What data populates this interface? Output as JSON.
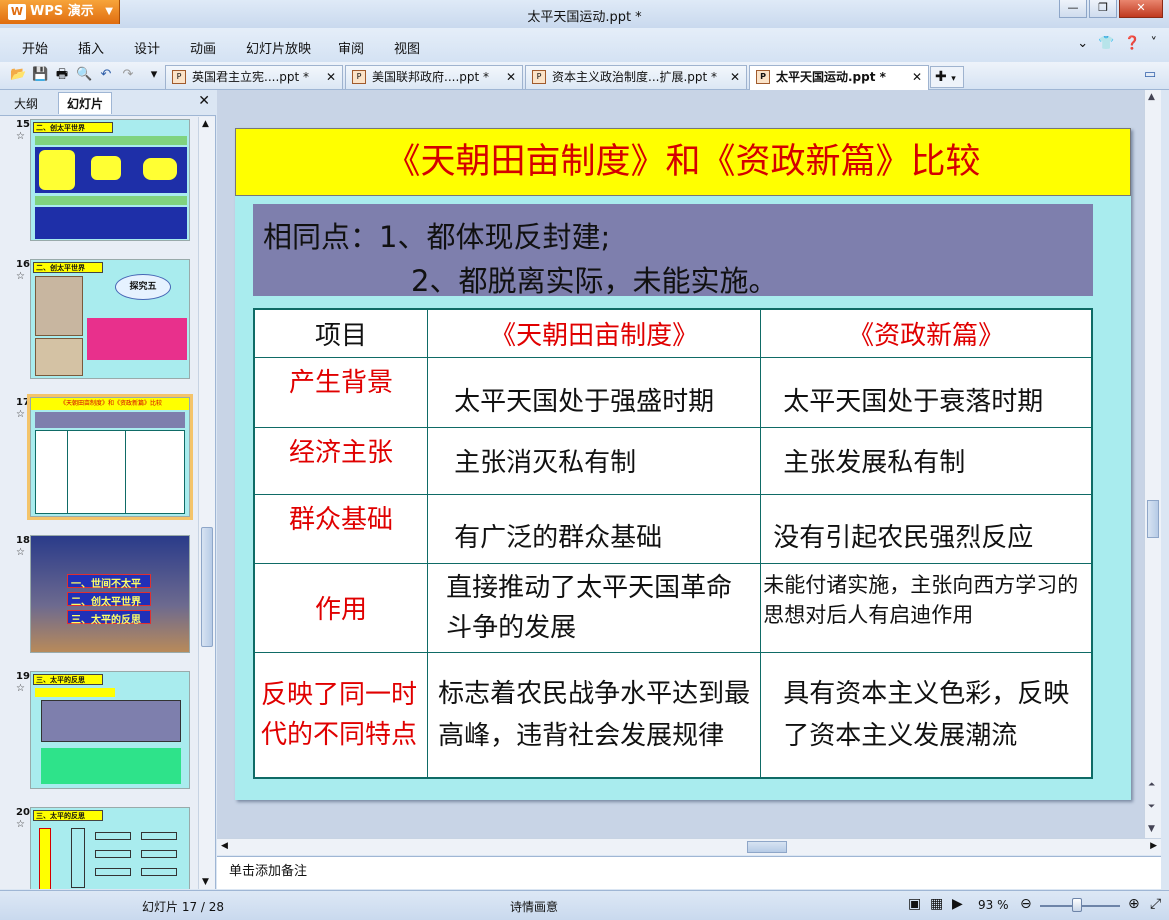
{
  "app": {
    "brand": "WPS 演示",
    "title": "太平天国运动.ppt *"
  },
  "menu": [
    "开始",
    "插入",
    "设计",
    "动画",
    "幻灯片放映",
    "审阅",
    "视图"
  ],
  "tabs": [
    {
      "label": "英国君主立宪....ppt *"
    },
    {
      "label": "美国联邦政府....ppt *"
    },
    {
      "label": "资本主义政治制度...扩展.ppt *"
    },
    {
      "label": "太平天国运动.ppt *",
      "active": true
    }
  ],
  "sidebar": {
    "tab_outline": "大纲",
    "tab_slides": "幻灯片",
    "thumbs": [
      {
        "num": "15",
        "title": "二、创太平世界"
      },
      {
        "num": "16",
        "title": "二、创太平世界",
        "bubble": "探究五"
      },
      {
        "num": "17",
        "title": "《天朝田亩制度》和《资政新篇》比较",
        "selected": true
      },
      {
        "num": "18",
        "items": [
          "一、世间不太平",
          "二、创太平世界",
          "三、太平的反思"
        ]
      },
      {
        "num": "19",
        "title": "三、太平的反思"
      },
      {
        "num": "20",
        "title": "三、太平的反思"
      }
    ]
  },
  "slide": {
    "title": "《天朝田亩制度》和《资政新篇》比较",
    "common_label": "相同点：",
    "common_1": "1、都体现反封建;",
    "common_2": "2、都脱离实际，未能实施。",
    "table": {
      "headers": [
        "项目",
        "《天朝田亩制度》",
        "《资政新篇》"
      ],
      "rows": [
        {
          "item": "产生背景",
          "a": "太平天国处于强盛时期",
          "b": "太平天国处于衰落时期"
        },
        {
          "item": "经济主张",
          "a": "主张消灭私有制",
          "b": "主张发展私有制"
        },
        {
          "item": "群众基础",
          "a": "有广泛的群众基础",
          "b": "没有引起农民强烈反应"
        },
        {
          "item": "作用",
          "a": "直接推动了太平天国革命斗争的发展",
          "b": "未能付诸实施，主张向西方学习的思想对后人有启迪作用"
        },
        {
          "item": "反映了同一时代的不同特点",
          "a": "标志着农民战争水平达到最高峰，违背社会发展规律",
          "b": "具有资本主义色彩，反映了资本主义发展潮流"
        }
      ]
    }
  },
  "notes_placeholder": "单击添加备注",
  "status": {
    "slide_counter": "幻灯片 17 / 28",
    "theme": "诗情画意",
    "zoom": "93 %"
  }
}
